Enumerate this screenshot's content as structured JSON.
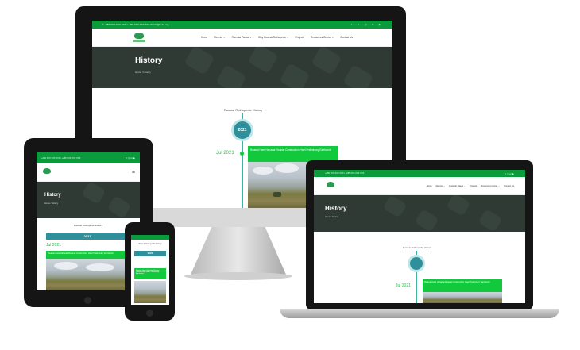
{
  "site": {
    "topbar_phone": "+256 XXX XXX XXX / +256 XXX XXX XXX",
    "topbar_email": "info@beira.org",
    "menu": [
      "Home",
      "Rwentu ⌄",
      "Rwentar Rasas ⌄",
      "Why Rwanai Rothopedic ⌄",
      "Projects",
      "Resources Center ⌄",
      "Contact Us"
    ],
    "hero_title": "History",
    "breadcrumb": "Home / History",
    "timeline_heading": "Rwanai Rothopedic History",
    "year_badge": "2021",
    "entry_date": "Jul 2021",
    "entry_text": "Rwanai Hwei Hahadai Rwanai Construction Hwei Preliminary Earthwork"
  },
  "tablet": {
    "heading": "Rwanai Rothopedic History",
    "year": "2021",
    "date": "Jul 2021",
    "entry": "Rwanai Hwei Hahadai Rwanai Construction Hwei Preliminary Earthwork",
    "title": "History",
    "breadcrumb": "Home / History"
  },
  "phone": {
    "heading": "Rwanai Rothopedic History",
    "year": "2021",
    "entry": "Rwanai Hwei Hahadai Rwanai Construction Hwei Preliminary Earthwork"
  },
  "laptop": {
    "heading": "Rwanai Rothopedic History",
    "date": "Jul 2021",
    "entry": "Rwanai Hwei Hahadai Rwanai Construction Hwei Preliminary Earthwork",
    "title": "History",
    "breadcrumb": "Home / History"
  },
  "colors": {
    "brand_green": "#0a9c3c",
    "accent_green": "#12c83c",
    "teal": "#2f8f9b",
    "hero_dark": "#2f3a35"
  },
  "icons": [
    "phone-icon",
    "email-icon",
    "facebook-icon",
    "twitter-icon",
    "instagram-icon",
    "linkedin-icon",
    "youtube-icon",
    "menu-icon"
  ]
}
